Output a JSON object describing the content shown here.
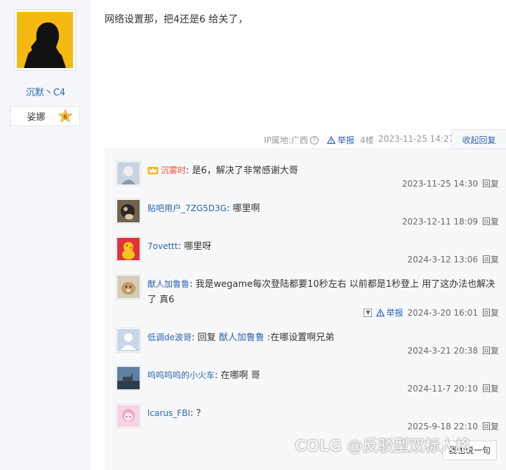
{
  "author": {
    "name": "沉默丶C4",
    "level_name": "娑娜",
    "level_number": "6"
  },
  "post": {
    "content": "网络设置那，把4还是6 给关了，",
    "ip_location": "IP属地:广西",
    "report_label": "举报",
    "floor": "4楼",
    "time": "2023-11-25 14:27",
    "collapse_label": "收起回复"
  },
  "replies": [
    {
      "user": "沉雾时",
      "vip": true,
      "text": "是6，解决了非常感谢大哥",
      "time": "2023-11-25 14:30",
      "reply_label": "回复",
      "avatar_color": "#c9d3e0"
    },
    {
      "user": "贴吧用户_7ZG5D3G",
      "vip": false,
      "text": "哪里啊",
      "time": "2023-12-11 18:09",
      "reply_label": "回复",
      "avatar_color": "#8a7a5e"
    },
    {
      "user": "7ovettt",
      "vip": false,
      "text": "哪里呀",
      "time": "2024-3-12 13:06",
      "reply_label": "回复",
      "avatar_color": "#e2323b"
    },
    {
      "user": "猷人加鲁鲁",
      "vip": false,
      "text": "我是wegame每次登陆都要10秒左右 以前都是1秒登上 用了这办法也解决了 真6",
      "time": "2024-3-20 16:01",
      "reply_label": "回复",
      "report_label": "举报",
      "avatar_color": "#b8a58e"
    },
    {
      "user": "低调de波哥",
      "vip": false,
      "text_prefix": "回复",
      "mention": "猷人加鲁鲁",
      "text": ":在哪设置啊兄弟",
      "time": "2024-3-21 20:38",
      "reply_label": "回复",
      "avatar_color": "#c9d6ea"
    },
    {
      "user": "呜呜呜呜的小火车",
      "vip": false,
      "text": "在哪啊 哥",
      "time": "2024-11-7 20:10",
      "reply_label": "回复",
      "avatar_color": "#3e5a7a"
    },
    {
      "user": "Icarus_FBI",
      "vip": false,
      "text": "？",
      "time": "2025-9-18 22:10",
      "reply_label": "回复",
      "avatar_color": "#f2b8d0"
    }
  ],
  "say_button": "我也说一句",
  "watermark": "COLG @反驳型双标人格"
}
